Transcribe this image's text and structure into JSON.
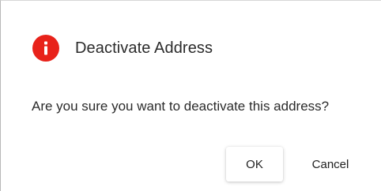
{
  "dialog": {
    "title": "Deactivate Address",
    "message": "Are you sure you want to deactivate this address?",
    "icon": "alert-info-icon",
    "accent_color": "#e8221a"
  },
  "actions": {
    "ok_label": "OK",
    "cancel_label": "Cancel"
  }
}
